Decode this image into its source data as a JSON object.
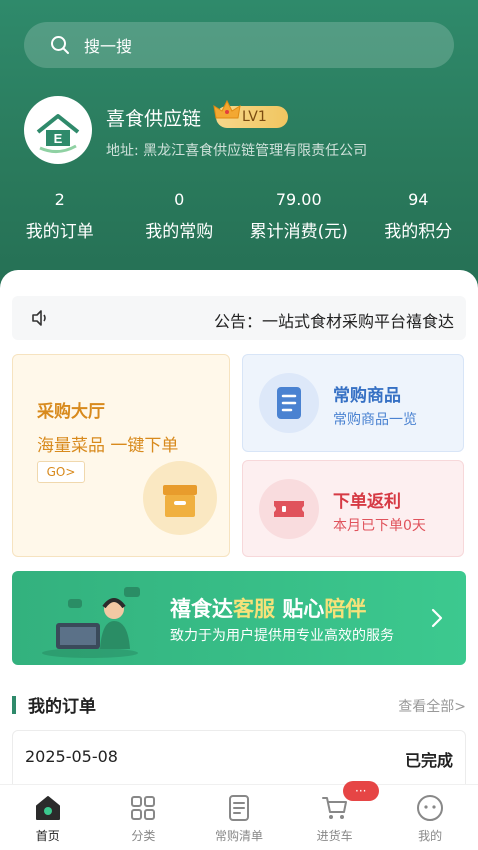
{
  "search": {
    "placeholder": "搜一搜"
  },
  "profile": {
    "shop_name": "喜食供应链",
    "level": "LV1",
    "address": "地址: 黑龙江喜食供应链管理有限责任公司"
  },
  "stats": [
    {
      "value": "2",
      "label": "我的订单"
    },
    {
      "value": "0",
      "label": "我的常购"
    },
    {
      "value": "79.00",
      "label": "累计消费(元)"
    },
    {
      "value": "94",
      "label": "我的积分"
    }
  ],
  "notice": {
    "text": "公告：一站式食材采购平台禧食达"
  },
  "cards": {
    "purchase_hall": {
      "title": "采购大厅",
      "subtitle": "海量菜品 一键下单",
      "go_label": "GO>"
    },
    "frequent": {
      "title": "常购商品",
      "subtitle": "常购商品一览"
    },
    "rebate": {
      "title": "下单返利",
      "subtitle": "本月已下单0天"
    }
  },
  "banner": {
    "brand": "禧食达",
    "service": "客服",
    "gap": "贴心",
    "companion": "陪伴",
    "subtitle": "致力于为用户提供用专业高效的服务"
  },
  "orders": {
    "section_title": "我的订单",
    "view_all": "查看全部>",
    "items": [
      {
        "date": "2025-05-08",
        "status": "已完成"
      }
    ]
  },
  "tabbar": {
    "items": [
      {
        "label": "首页",
        "icon": "home-icon"
      },
      {
        "label": "分类",
        "icon": "grid-icon"
      },
      {
        "label": "常购清单",
        "icon": "list-icon"
      },
      {
        "label": "进货车",
        "icon": "cart-icon",
        "badge": "···"
      },
      {
        "label": "我的",
        "icon": "face-icon"
      }
    ]
  },
  "colors": {
    "primary_green": "#2f8a6b",
    "purchase_orange": "#d88a1d",
    "frequent_blue": "#3670c4",
    "rebate_red": "#d63a44",
    "badge_red": "#e64545"
  }
}
